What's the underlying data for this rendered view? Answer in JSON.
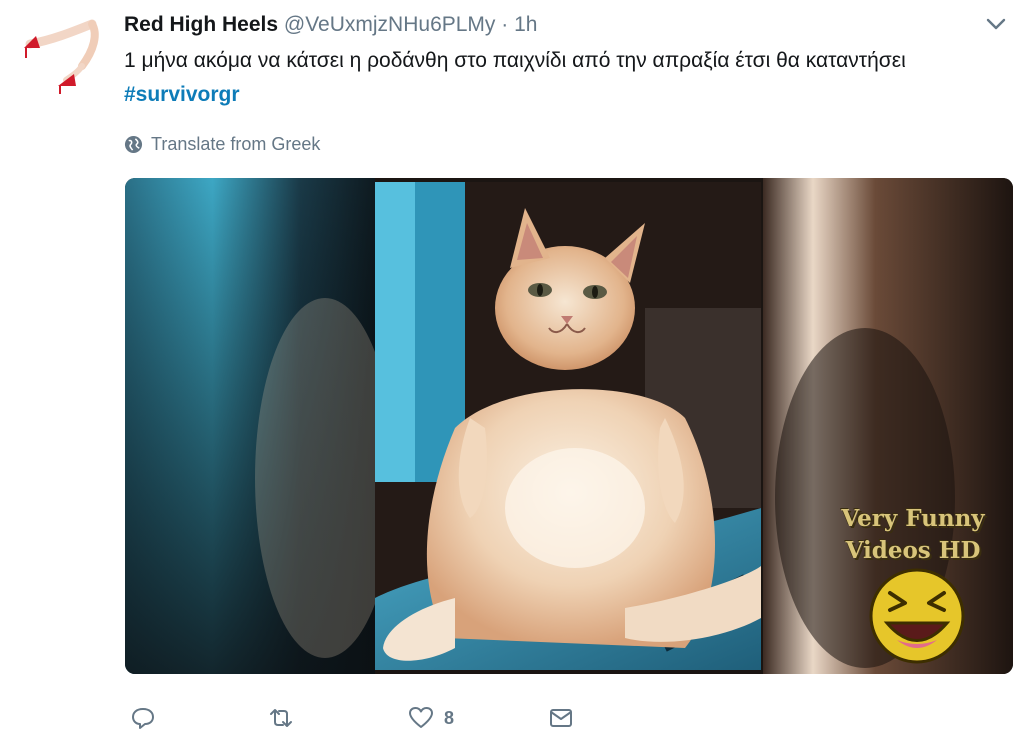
{
  "tweet": {
    "author_name": "Red High Heels",
    "author_handle": "@VeUxmjzNHu6PLMy",
    "separator": "·",
    "timestamp": "1h",
    "text": "1 μήνα ακόμα να κάτσει η ροδάνθη στο παιχνίδι από την απραξία έτσι θα καταντήσει",
    "hashtag": "#survivorgr",
    "translate_label": "Translate from Greek"
  },
  "media": {
    "watermark_line1": "Very Funny",
    "watermark_line2": "Videos HD"
  },
  "actions": {
    "reply_count": "",
    "retweet_count": "",
    "like_count": "8",
    "message_count": ""
  },
  "icons": {
    "avatar": "high-heels-legs-avatar",
    "menu": "chevron-down-icon",
    "translate": "globe-icon",
    "reply": "reply-icon",
    "retweet": "retweet-icon",
    "like": "heart-icon",
    "message": "envelope-icon"
  },
  "colors": {
    "hashtag": "#0e7cb8",
    "muted": "#657786",
    "text": "#14171a"
  }
}
